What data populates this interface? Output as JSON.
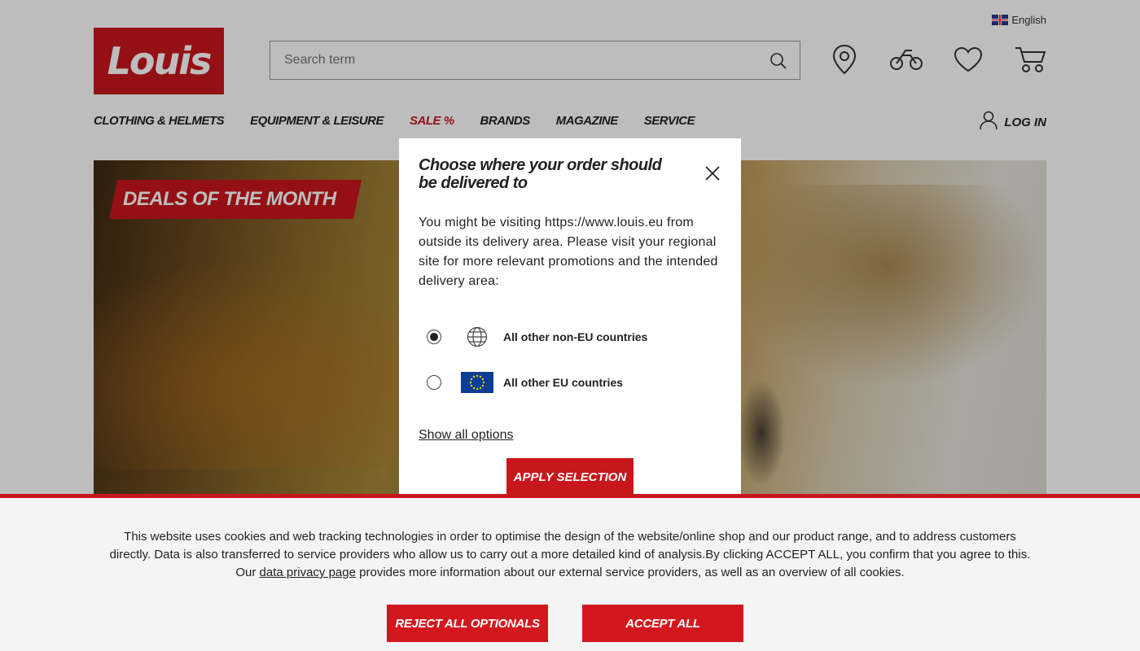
{
  "header": {
    "language": "English",
    "logo_text": "Louis",
    "search_placeholder": "Search term",
    "login_label": "LOG IN"
  },
  "nav": {
    "items": [
      {
        "label": "CLOTHING & HELMETS"
      },
      {
        "label": "EQUIPMENT & LEISURE"
      },
      {
        "label": "SALE %"
      },
      {
        "label": "BRANDS"
      },
      {
        "label": "MAGAZINE"
      },
      {
        "label": "SERVICE"
      }
    ]
  },
  "hero": {
    "badge": "DEALS OF THE MONTH"
  },
  "modal": {
    "title": "Choose where your order should be delivered to",
    "body": "You might be visiting https://www.louis.eu from outside its delivery area. Please visit your regional site for more relevant promotions and the intended delivery area:",
    "options": [
      {
        "label": "All other non-EU countries",
        "selected": true,
        "icon": "globe-icon"
      },
      {
        "label": "All other EU countries",
        "selected": false,
        "icon": "eu-flag-icon"
      }
    ],
    "show_all": "Show all options",
    "apply": "APPLY SELECTION"
  },
  "cookie": {
    "text_before": "This website uses cookies and web tracking technologies in order to optimise the design of the website/online shop and our product range, and to address customers directly. Data is also transferred to service providers who allow us to carry out a more detailed kind of analysis.By clicking ACCEPT ALL, you confirm that you agree to this. Our ",
    "link": "data privacy page",
    "text_after": " provides more information about our external service providers, as well as an overview of all cookies.",
    "reject": "REJECT ALL OPTIONALS",
    "accept": "ACCEPT ALL"
  },
  "colors": {
    "brand_red": "#c8161d"
  }
}
